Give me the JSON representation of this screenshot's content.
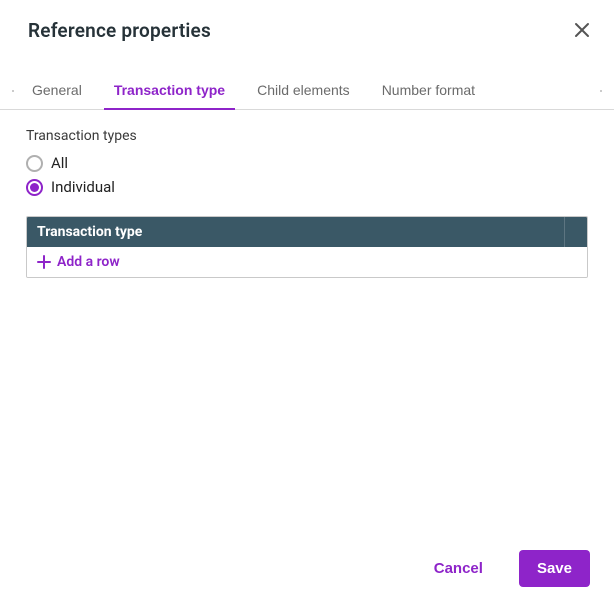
{
  "dialog_title": "Reference properties",
  "tabs": {
    "general": "General",
    "transaction_type": "Transaction type",
    "child_elements": "Child elements",
    "number_format": "Number format"
  },
  "section": {
    "label": "Transaction types",
    "radio_all": "All",
    "radio_individual": "Individual"
  },
  "table": {
    "header": "Transaction type",
    "add_row": "Add a row"
  },
  "footer": {
    "cancel": "Cancel",
    "save": "Save"
  }
}
